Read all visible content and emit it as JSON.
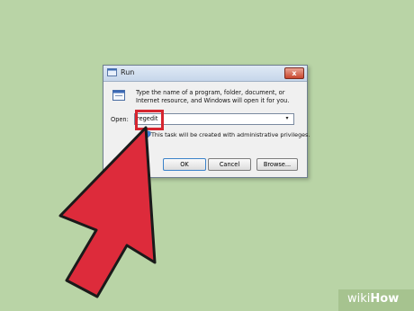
{
  "dialog": {
    "title": "Run",
    "close_symbol": "x",
    "description": "Type the name of a program, folder, document, or Internet resource, and Windows will open it for you.",
    "open_label": "Open:",
    "open_value": "regedit",
    "admin_note": "This task will be created with administrative privileges.",
    "buttons": {
      "ok": "OK",
      "cancel": "Cancel",
      "browse": "Browse..."
    }
  },
  "watermark": {
    "wiki": "wiki",
    "how": "How"
  },
  "colors": {
    "background": "#b9d4a6",
    "arrow": "#dd2b3b",
    "highlight": "#d6252f"
  },
  "icons": [
    "run-icon",
    "app-icon",
    "shield-icon",
    "close-icon",
    "chevron-down-icon"
  ]
}
